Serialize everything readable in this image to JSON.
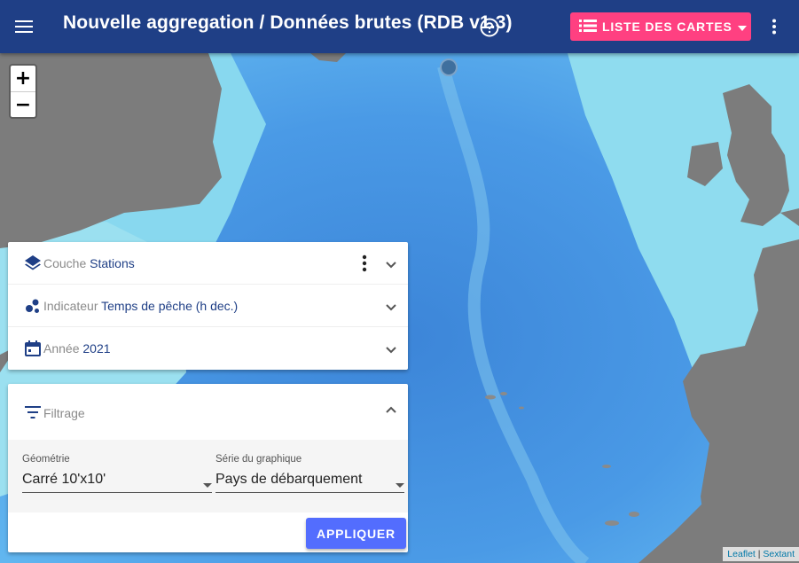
{
  "toolbar": {
    "title": "Nouvelle aggregation / Données brutes (RDB v1.3)",
    "maps_button_label": "LISTE DES CARTES",
    "colors": {
      "background": "#1f3f86",
      "accent": "#ff4081"
    }
  },
  "map": {
    "zoom_in": "+",
    "zoom_out": "−",
    "attribution": {
      "leaflet": "Leaflet",
      "separator": " | ",
      "sextant": "Sextant"
    }
  },
  "layers_panel": {
    "rows": [
      {
        "key": "Couche",
        "value": "Stations",
        "icon": "layers-icon"
      },
      {
        "key": "Indicateur",
        "value": "Temps de pêche (h dec.)",
        "icon": "bubble-chart-icon"
      },
      {
        "key": "Année",
        "value": "2021",
        "icon": "calendar-icon"
      }
    ]
  },
  "filter_panel": {
    "title": "Filtrage",
    "geometry": {
      "label": "Géométrie",
      "value": "Carré 10'x10'"
    },
    "serie": {
      "label": "Série du graphique",
      "value": "Pays de débarquement"
    },
    "apply_label": "APPLIQUER",
    "apply_color": "#536dfe"
  }
}
